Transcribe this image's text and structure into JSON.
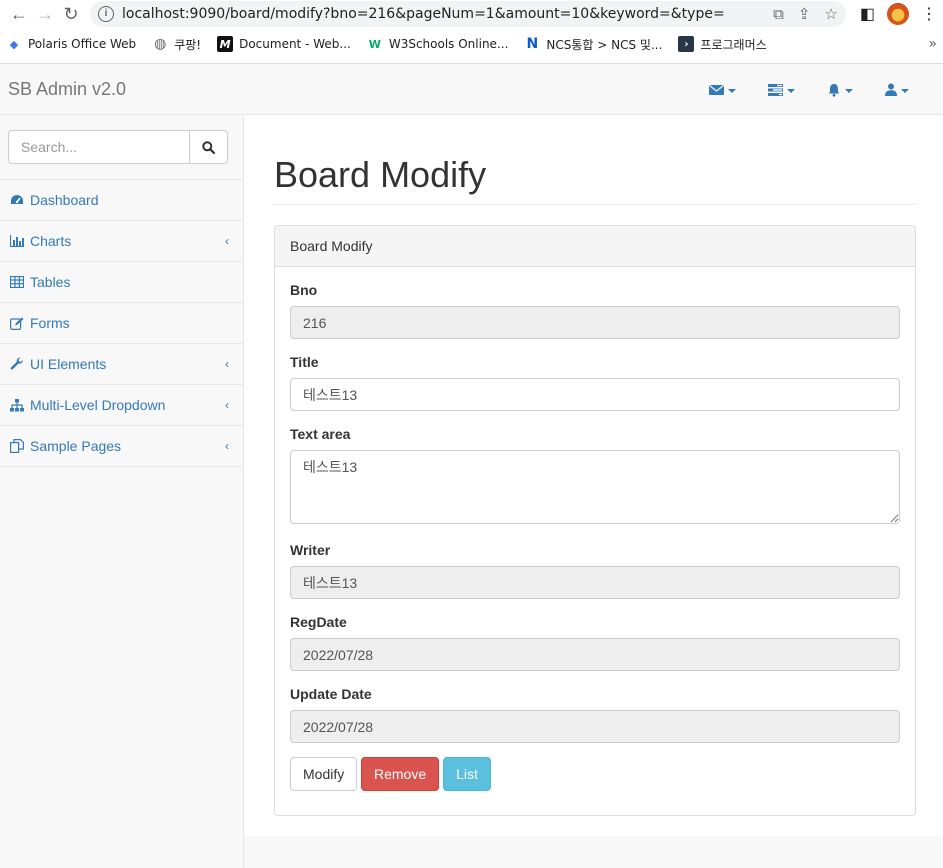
{
  "browser": {
    "url": "localhost:9090/board/modify?bno=216&pageNum=1&amount=10&keyword=&type=",
    "bookmarks": [
      {
        "label": "Polaris Office Web",
        "icon": "polaris-icon",
        "color": "#3d7be0"
      },
      {
        "label": "쿠팡!",
        "icon": "globe-icon",
        "color": "#5f6368"
      },
      {
        "label": "Document - Web...",
        "icon": "m-icon",
        "color": "#111111"
      },
      {
        "label": "W3Schools Online...",
        "icon": "w3-icon",
        "color": "#04aa6d"
      },
      {
        "label": "NCS통합 > NCS 및...",
        "icon": "ncs-icon",
        "color": "#0b5bd3"
      },
      {
        "label": "프로그래머스",
        "icon": "programmers-icon",
        "color": "#263747"
      }
    ],
    "more_label": "»"
  },
  "navbar": {
    "brand": "SB Admin v2.0",
    "dropdowns": [
      {
        "name": "messages",
        "icon": "envelope-icon"
      },
      {
        "name": "tasks",
        "icon": "tasks-icon"
      },
      {
        "name": "alerts",
        "icon": "bell-icon"
      },
      {
        "name": "user",
        "icon": "user-icon"
      }
    ]
  },
  "sidebar": {
    "search_placeholder": "Search...",
    "items": [
      {
        "label": "Dashboard",
        "icon": "dashboard-icon",
        "has_arrow": false
      },
      {
        "label": "Charts",
        "icon": "bar-chart-icon",
        "has_arrow": true
      },
      {
        "label": "Tables",
        "icon": "table-icon",
        "has_arrow": false
      },
      {
        "label": "Forms",
        "icon": "edit-icon",
        "has_arrow": false
      },
      {
        "label": "UI Elements",
        "icon": "wrench-icon",
        "has_arrow": true
      },
      {
        "label": "Multi-Level Dropdown",
        "icon": "sitemap-icon",
        "has_arrow": true
      },
      {
        "label": "Sample Pages",
        "icon": "files-icon",
        "has_arrow": true
      }
    ],
    "arrow_glyph": "‹"
  },
  "page": {
    "title": "Board Modify",
    "panel_heading": "Board Modify",
    "fields": {
      "bno": {
        "label": "Bno",
        "value": "216"
      },
      "title": {
        "label": "Title",
        "value": "테스트13"
      },
      "content": {
        "label": "Text area",
        "value": "테스트13"
      },
      "writer": {
        "label": "Writer",
        "value": "테스트13"
      },
      "regdate": {
        "label": "RegDate",
        "value": "2022/07/28"
      },
      "updatedate": {
        "label": "Update Date",
        "value": "2022/07/28"
      }
    },
    "buttons": {
      "modify": "Modify",
      "remove": "Remove",
      "list": "List"
    }
  },
  "colors": {
    "link": "#337ab7",
    "danger": "#d9534f",
    "info": "#5bc0de"
  }
}
